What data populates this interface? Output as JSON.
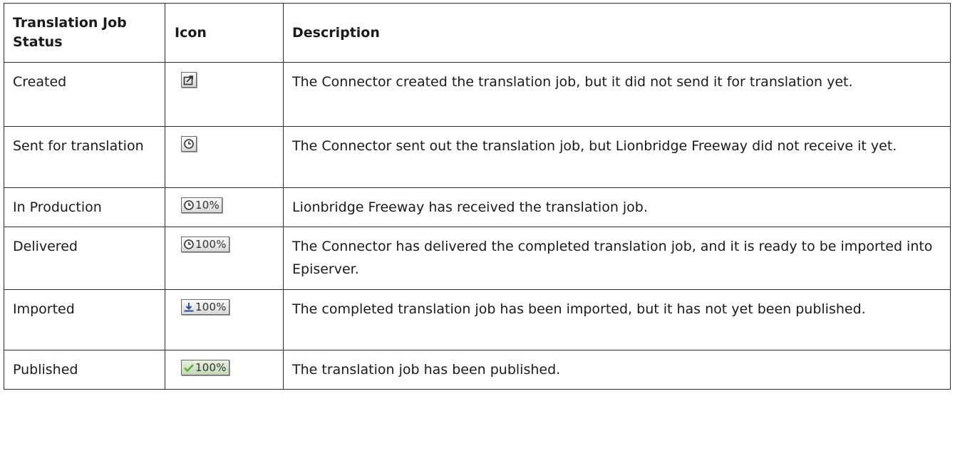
{
  "table": {
    "headers": {
      "status": "Translation Job Status",
      "icon": "Icon",
      "description": "Description"
    },
    "rows": [
      {
        "status": "Created",
        "icon": "created-icon",
        "icon_text": "",
        "description": "The Connector created the translation job, but it did not send it for translation yet."
      },
      {
        "status": "Sent for translation",
        "icon": "clock-icon",
        "icon_text": "",
        "description": "The Connector sent out the translation job, but Lionbridge Freeway did not receive it yet."
      },
      {
        "status": "In Production",
        "icon": "clock-icon",
        "icon_text": "10%",
        "description": "Lionbridge Freeway has received the translation job."
      },
      {
        "status": "Delivered",
        "icon": "clock-icon",
        "icon_text": "100%",
        "description": "The Connector has delivered the completed translation job, and it is ready to be imported into Episerver."
      },
      {
        "status": "Imported",
        "icon": "download-icon",
        "icon_text": "100%",
        "description": "The completed translation job has been imported, but it has not yet been published."
      },
      {
        "status": "Published",
        "icon": "checkmark-icon",
        "icon_text": "100%",
        "description": "The translation job has been published."
      }
    ]
  },
  "colors": {
    "border": "#2b2b2b",
    "check_green": "#5fae3a"
  }
}
